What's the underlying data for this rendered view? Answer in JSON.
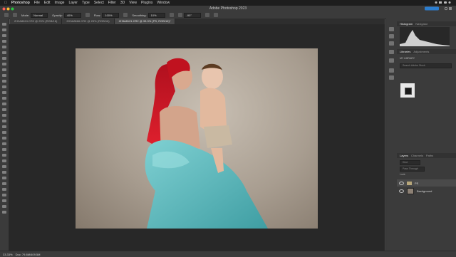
{
  "menubar": {
    "app": "Photoshop",
    "items": [
      "File",
      "Edit",
      "Image",
      "Layer",
      "Type",
      "Select",
      "Filter",
      "3D",
      "View",
      "Plugins",
      "Window"
    ]
  },
  "window": {
    "title": "Adobe Photoshop 2023"
  },
  "options": {
    "mode_label": "Mode:",
    "mode_value": "Normal",
    "opacity_label": "Opacity:",
    "opacity_value": "40%",
    "flow_label": "Flow:",
    "flow_value": "100%",
    "smoothing_label": "Smoothing:",
    "smoothing_value": "10%",
    "angle_value": "-90°"
  },
  "tabs": [
    {
      "label": "2H3A8624.CR2 @ 25% (RGB/16)"
    },
    {
      "label": "2H3A8666.CR2 @ 25% (RGB/16)"
    },
    {
      "label": "2H3A8121.CR2 @ 33.3% (PS, RGB/16)*"
    }
  ],
  "status": {
    "zoom": "33.33%",
    "doc": "Doc: 79.8M/409.5M"
  },
  "panels": {
    "top_tabs": [
      "Histogram",
      "Navigator"
    ],
    "library_tabs": [
      "Libraries",
      "Adjustments"
    ],
    "library_name": "MY LIBRARY",
    "library_search": "Search Adobe Stock",
    "layers_tabs": [
      "Layers",
      "Channels",
      "Paths"
    ],
    "kind_label": "Kind",
    "pass_through": "Pass Through",
    "lock_label": "Lock:",
    "layers": [
      {
        "name": "PS",
        "type": "group"
      },
      {
        "name": "Background",
        "type": "image"
      }
    ]
  },
  "colors": {
    "accent": "#2c7ecf",
    "background": "#282828"
  }
}
